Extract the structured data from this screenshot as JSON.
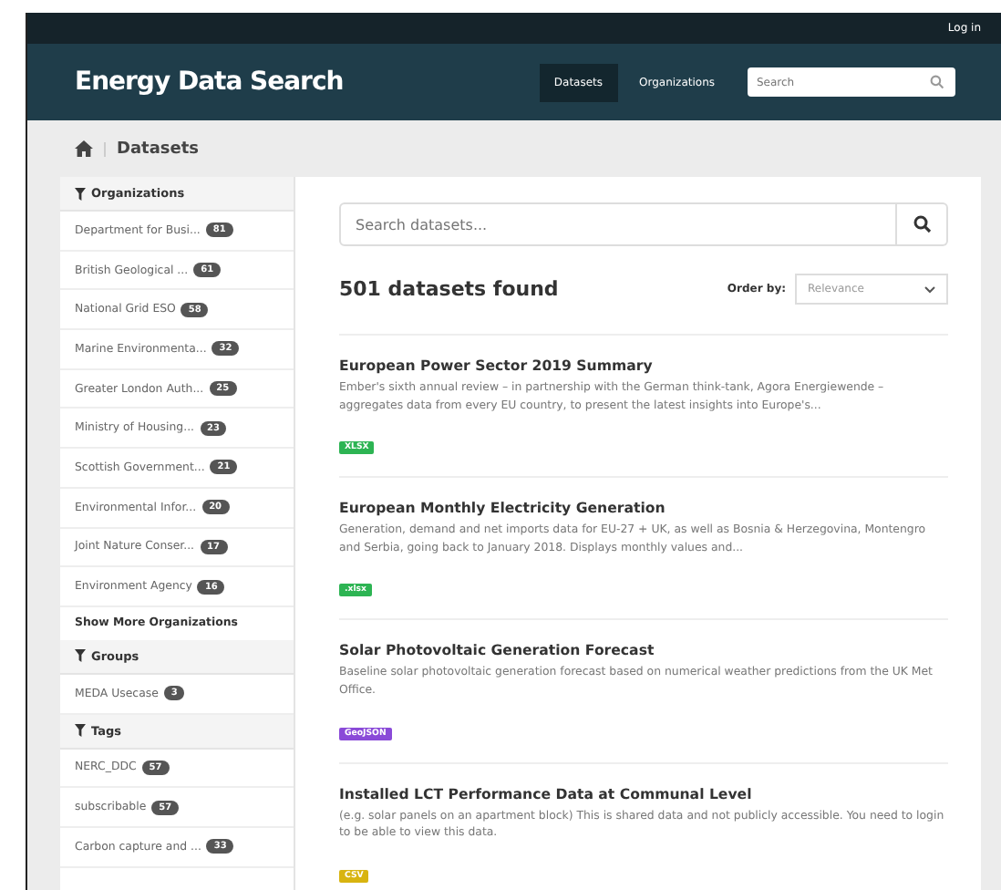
{
  "topbar": {
    "login": "Log in"
  },
  "header": {
    "title": "Energy Data Search",
    "nav": [
      {
        "label": "Datasets",
        "selected": true
      },
      {
        "label": "Organizations",
        "selected": false
      }
    ],
    "search": {
      "placeholder": "Search"
    }
  },
  "breadcrumb": {
    "current": "Datasets"
  },
  "sidebar": {
    "sections": [
      {
        "title": "Organizations",
        "items": [
          {
            "label": "Department for Busi...",
            "count": "81"
          },
          {
            "label": "British Geological ...",
            "count": "61"
          },
          {
            "label": "National Grid ESO",
            "count": "58"
          },
          {
            "label": "Marine Environmenta...",
            "count": "32"
          },
          {
            "label": "Greater London Auth...",
            "count": "25"
          },
          {
            "label": "Ministry of Housing...",
            "count": "23"
          },
          {
            "label": "Scottish Government...",
            "count": "21"
          },
          {
            "label": "Environmental Infor...",
            "count": "20"
          },
          {
            "label": "Joint Nature Conser...",
            "count": "17"
          },
          {
            "label": "Environment Agency",
            "count": "16"
          }
        ],
        "more": "Show More Organizations"
      },
      {
        "title": "Groups",
        "items": [
          {
            "label": "MEDA Usecase",
            "count": "3"
          }
        ]
      },
      {
        "title": "Tags",
        "items": [
          {
            "label": "NERC_DDC",
            "count": "57"
          },
          {
            "label": "subscribable",
            "count": "57"
          },
          {
            "label": "Carbon capture and ...",
            "count": "33"
          }
        ]
      }
    ]
  },
  "main": {
    "search": {
      "placeholder": "Search datasets..."
    },
    "found": "501 datasets found",
    "order_label": "Order by:",
    "order_value": "Relevance",
    "datasets": [
      {
        "title": "European Power Sector 2019 Summary",
        "description": "Ember's sixth annual review – in partnership with the German think-tank, Agora Energiewende – aggregates data from every EU country, to present the latest insights into Europe's...",
        "format": "XLSX",
        "color": "#2db453"
      },
      {
        "title": "European Monthly Electricity Generation",
        "description": "Generation, demand and net imports data for EU-27 + UK, as well as Bosnia & Herzegovina, Montengro and Serbia, going back to January 2018. Displays monthly values and...",
        "format": ".xlsx",
        "color": "#2db453"
      },
      {
        "title": "Solar Photovoltaic Generation Forecast",
        "description": "Baseline solar photovoltaic generation forecast based on numerical weather predictions from the UK Met Office.",
        "format": "GeoJSON",
        "color": "#8a4ad8"
      },
      {
        "title": "Installed LCT Performance Data at Communal Level",
        "description": "(e.g. solar panels on an apartment block) This is shared data and not publicly accessible. You need to login to be able to view this data.",
        "format": "CSV",
        "color": "#d8b410"
      }
    ]
  }
}
